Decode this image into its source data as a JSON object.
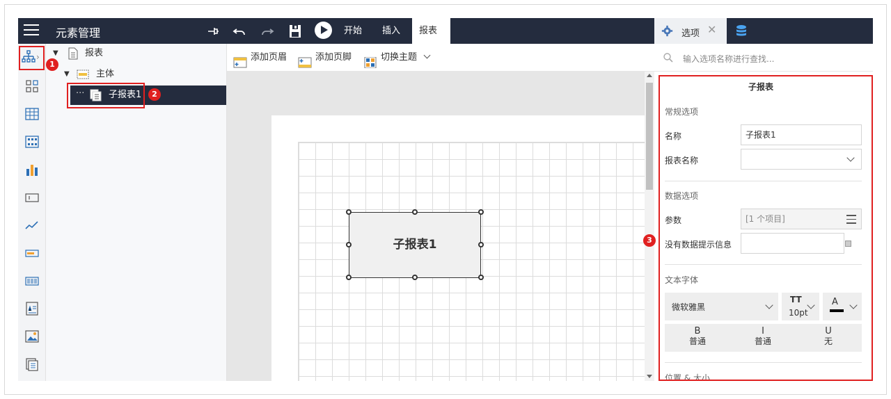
{
  "app": {
    "title": "元素管理"
  },
  "toolbar": {
    "tabs": [
      "开始",
      "插入",
      "报表"
    ],
    "active_tab": "报表"
  },
  "right_tabs": {
    "options_label": "选项"
  },
  "tree": {
    "root": "报表",
    "body": "主体",
    "selected": "子报表1"
  },
  "canvas_toolbar": {
    "add_header": "添加页眉",
    "add_footer": "添加页脚",
    "switch_theme": "切换主题"
  },
  "canvas": {
    "subreport_label": "子报表1"
  },
  "badges": [
    "1",
    "2",
    "3"
  ],
  "search": {
    "placeholder": "输入选项名称进行查找..."
  },
  "properties": {
    "title": "子报表",
    "general_section": "常规选项",
    "name_label": "名称",
    "name_value": "子报表1",
    "report_name_label": "报表名称",
    "report_name_value": "",
    "data_section": "数据选项",
    "params_label": "参数",
    "params_value": "[1 个项目]",
    "nodata_label": "没有数据提示信息",
    "nodata_value": "",
    "font_section": "文本字体",
    "font_family": "微软雅黑",
    "font_size": "10pt",
    "font_color_glyph": "A",
    "bold_glyph": "B",
    "bold_value": "普通",
    "italic_glyph": "I",
    "italic_value": "普通",
    "underline_glyph": "U",
    "underline_value": "无",
    "position_section": "位置 & 大小"
  },
  "colors": {
    "topbar": "#242c3e",
    "accent": "#1e88e5",
    "highlight": "#e02020"
  }
}
